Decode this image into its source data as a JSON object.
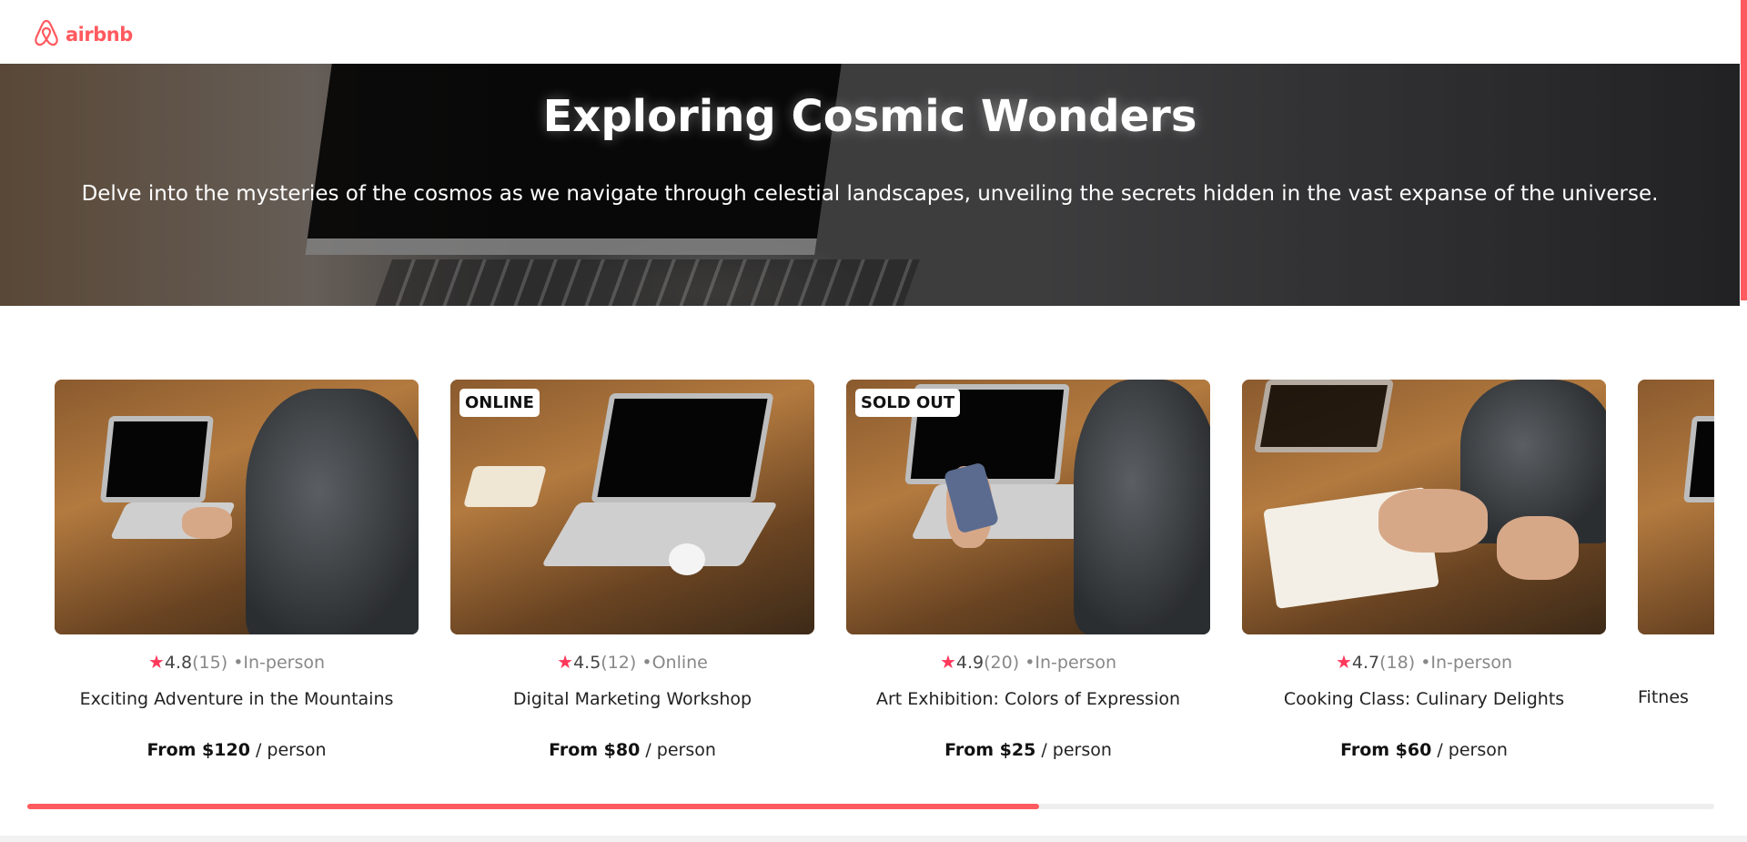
{
  "brand": {
    "name": "airbnb",
    "icon": "airbnb-logo-icon",
    "color": "#FF5A5F"
  },
  "hero": {
    "title": "Exploring Cosmic Wonders",
    "description": "Delve into the mysteries of the cosmos as we navigate through celestial landscapes, unveiling the secrets hidden in the vast expanse of the universe."
  },
  "cards": [
    {
      "badge": "",
      "rating": "4.8",
      "reviews": "(15)",
      "type": "•In-person",
      "title": "Exciting Adventure in the Mountains",
      "price": "From $120",
      "unit": " / person"
    },
    {
      "badge": "ONLINE",
      "rating": "4.5",
      "reviews": "(12)",
      "type": "•Online",
      "title": "Digital Marketing Workshop",
      "price": "From $80",
      "unit": " / person"
    },
    {
      "badge": "SOLD OUT",
      "rating": "4.9",
      "reviews": "(20)",
      "type": "•In-person",
      "title": "Art Exhibition: Colors of Expression",
      "price": "From $25",
      "unit": " / person"
    },
    {
      "badge": "",
      "rating": "4.7",
      "reviews": "(18)",
      "type": "•In-person",
      "title": "Cooking Class: Culinary Delights",
      "price": "From $60",
      "unit": " / person"
    },
    {
      "badge": "",
      "rating": "",
      "reviews": "",
      "type": "",
      "title": "Fitnes",
      "price": "",
      "unit": ""
    }
  ],
  "carousel": {
    "progress_fraction": 0.6
  },
  "colors": {
    "accent": "#FF5A5F",
    "star": "#FF385C"
  }
}
